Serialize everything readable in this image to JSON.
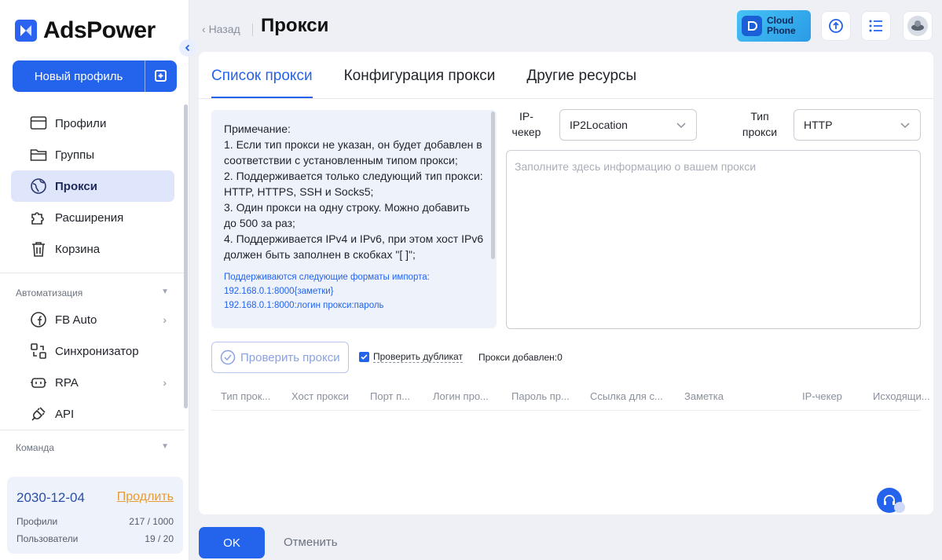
{
  "app": {
    "name": "AdsPower"
  },
  "sidebar": {
    "new_profile": "Новый профиль",
    "items": [
      {
        "label": "Профили",
        "icon": "profiles-icon"
      },
      {
        "label": "Группы",
        "icon": "folder-icon"
      },
      {
        "label": "Прокси",
        "icon": "globe-icon",
        "active": true
      },
      {
        "label": "Расширения",
        "icon": "puzzle-icon"
      },
      {
        "label": "Корзина",
        "icon": "trash-icon"
      }
    ],
    "automation_title": "Автоматизация",
    "automation_items": [
      {
        "label": "FB Auto",
        "icon": "facebook-icon"
      },
      {
        "label": "Синхронизатор",
        "icon": "sync-icon"
      },
      {
        "label": "RPA",
        "icon": "robot-icon"
      },
      {
        "label": "API",
        "icon": "plug-icon"
      }
    ],
    "team_title": "Команда",
    "subscription": {
      "date": "2030-12-04",
      "renew": "Продлить",
      "profiles_label": "Профили",
      "profiles_value": "217 / 1000",
      "users_label": "Пользователи",
      "users_value": "19 / 20"
    }
  },
  "header": {
    "back": "Назад",
    "title": "Прокси",
    "cloud_phone_line1": "Cloud",
    "cloud_phone_line2": "Phone"
  },
  "tabs": [
    "Список прокси",
    "Конфигурация прокси",
    "Другие ресурсы"
  ],
  "note": {
    "lines": [
      "Примечание:",
      "1. Если тип прокси не указан, он будет добавлен в соответствии с установленным типом прокси;",
      "2. Поддерживается только следующий тип прокси: HTTP, HTTPS, SSH и Socks5;",
      "3. Один прокси на одну строку. Можно добавить до 500 за раз;",
      "4. Поддерживается IPv4 и IPv6, при этом хост IPv6 должен быть заполнен в скобках \"[ ]\";"
    ],
    "formats_title": "Поддерживаются следующие форматы импорта:",
    "formats": [
      "192.168.0.1:8000{заметки}",
      "192.168.0.1:8000:логин прокси:пароль"
    ]
  },
  "form": {
    "ip_checker_label_1": "IP-",
    "ip_checker_label_2": "чекер",
    "ip_checker_value": "IP2Location",
    "proxy_type_label_1": "Тип",
    "proxy_type_label_2": "прокси",
    "proxy_type_value": "HTTP",
    "textarea_placeholder": "Заполните здесь информацию о вашем прокси"
  },
  "actions": {
    "check_proxy": "Проверить прокси",
    "check_duplicate": "Проверить дубликат",
    "proxies_added": "Прокси добавлен:0"
  },
  "table": {
    "columns": [
      "Тип прок...",
      "Хост прокси",
      "Порт п...",
      "Логин про...",
      "Пароль пр...",
      "Ссылка для с...",
      "Заметка",
      "IP-чекер",
      "Исходящи..."
    ]
  },
  "footer": {
    "ok": "OK",
    "cancel": "Отменить"
  },
  "colors": {
    "accent": "#2463eb",
    "active_nav_bg": "#dfe6fb",
    "note_bg": "#eef2fb"
  }
}
